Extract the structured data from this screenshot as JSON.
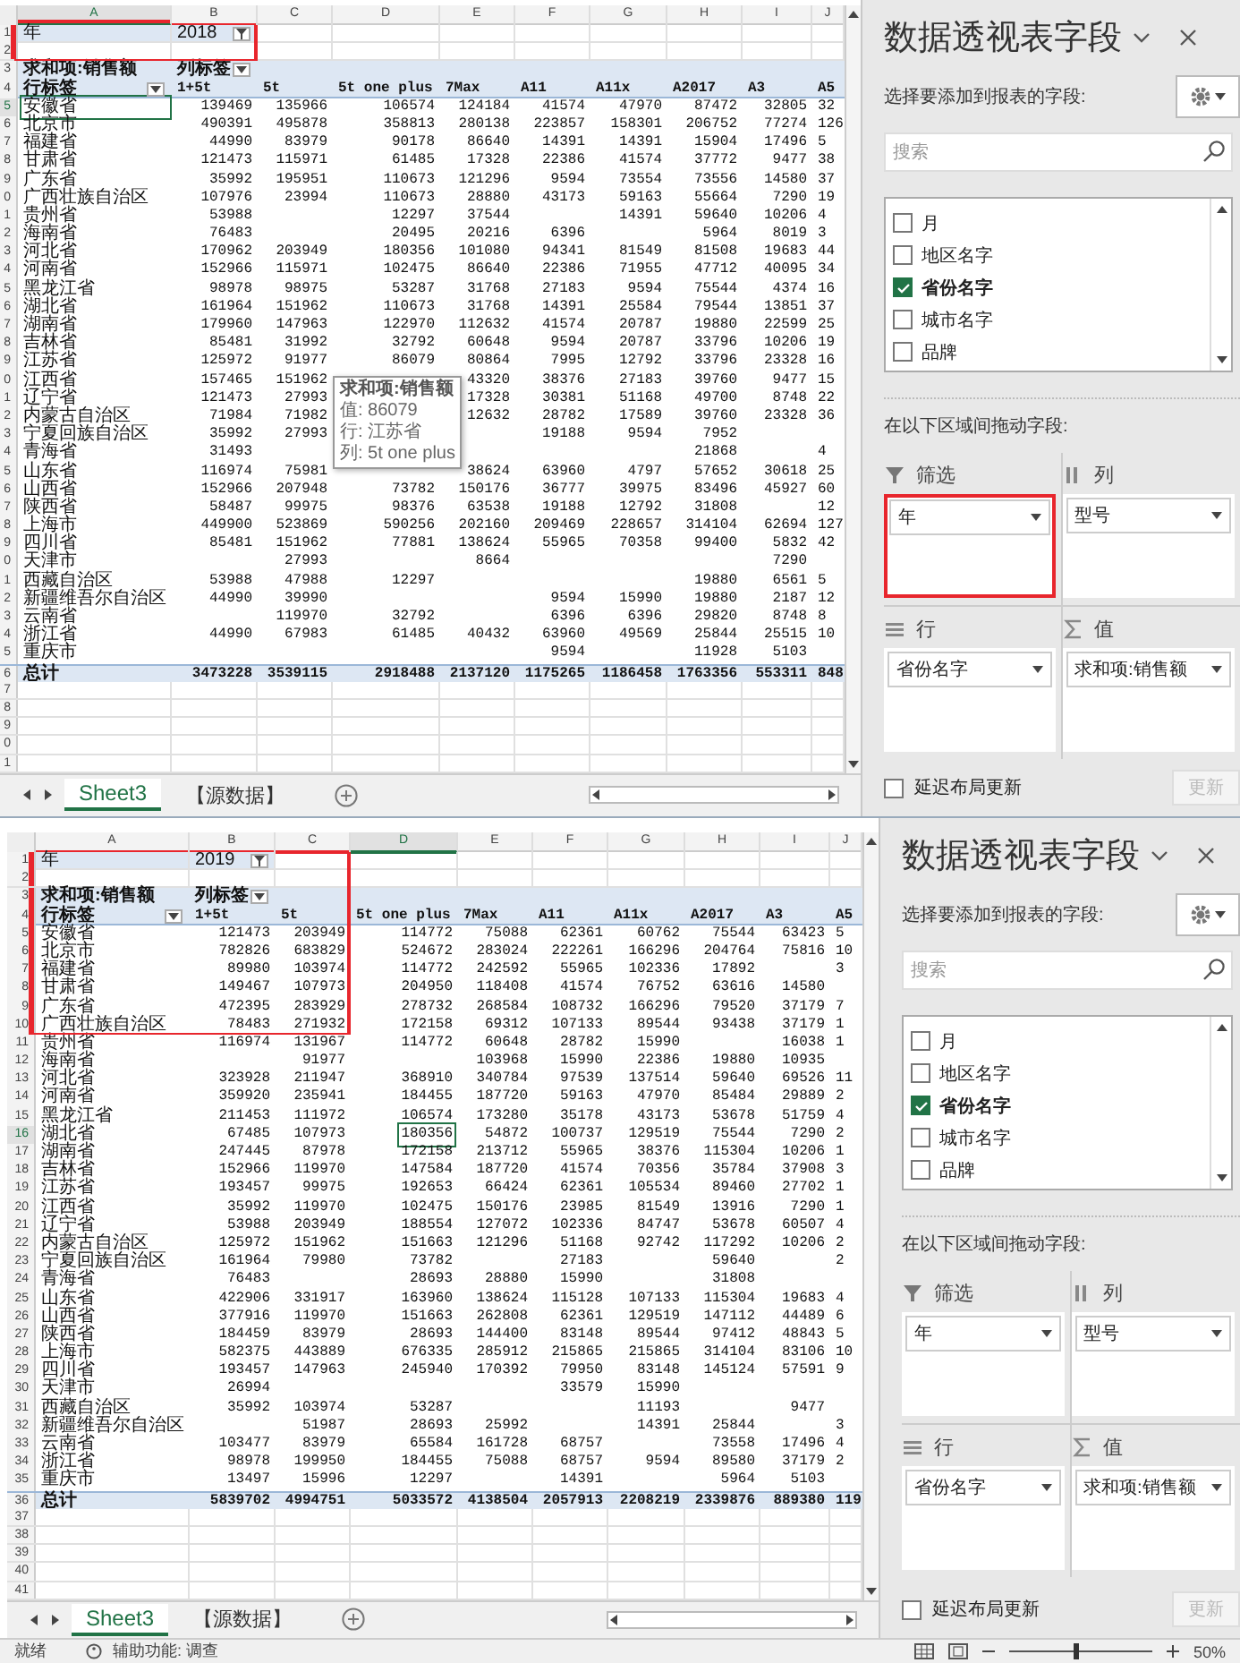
{
  "panes": [
    {
      "sheet": {
        "column_letters": [
          {
            "label": "A",
            "selected": true,
            "framed": true
          },
          {
            "label": "B",
            "selected": false,
            "framed": true
          },
          {
            "label": "C",
            "selected": false,
            "framed": false
          },
          {
            "label": "D",
            "selected": false,
            "framed": false
          },
          {
            "label": "E",
            "selected": false,
            "framed": false
          },
          {
            "label": "F",
            "selected": false,
            "framed": false
          },
          {
            "label": "G",
            "selected": false,
            "framed": false
          },
          {
            "label": "H",
            "selected": false,
            "framed": false
          },
          {
            "label": "I",
            "selected": false,
            "framed": false
          },
          {
            "label": "J",
            "selected": false,
            "framed": false
          }
        ],
        "tooltip": {
          "title": "求和项:销售额",
          "lines": [
            "值: 86079",
            "行: 江苏省",
            "列: 5t one plus"
          ]
        },
        "rows": [
          {
            "kind": "frame",
            "rows": [
              {
                "number": "1",
                "kind": "filter",
                "selected": false,
                "cells": [
                  "年",
                  "2018",
                  null,
                  null,
                  null,
                  null,
                  null,
                  null,
                  null,
                  null
                ]
              },
              {
                "number": "2",
                "kind": "blank",
                "selected": false
              }
            ]
          },
          {
            "number": "3",
            "kind": "header",
            "selected": false,
            "cells": [
              "求和项:销售额",
              "列标签",
              null,
              null,
              null,
              null,
              null,
              null,
              null,
              null
            ]
          },
          {
            "number": "4",
            "kind": "columns",
            "selected": false,
            "cells": [
              "行标签",
              "1+5t",
              "5t",
              "5t one plus",
              "7Max",
              "A11",
              "A11x",
              "A2017",
              "A3",
              "A5"
            ]
          },
          {
            "number": "5",
            "kind": "data",
            "selected": true,
            "cells": [
              "安徽省",
              "139469",
              "135966",
              "106574",
              "124184",
              "41574",
              "47970",
              "87472",
              "32805",
              "32"
            ]
          },
          {
            "number": "6",
            "kind": "data",
            "selected": false,
            "cells": [
              "北京市",
              "490391",
              "495878",
              "358813",
              "280138",
              "223857",
              "158301",
              "206752",
              "77274",
              "126"
            ]
          },
          {
            "number": "7",
            "kind": "data",
            "selected": false,
            "cells": [
              "福建省",
              "44990",
              "83979",
              "90178",
              "86640",
              "14391",
              "14391",
              "15904",
              "17496",
              "5"
            ]
          },
          {
            "number": "8",
            "kind": "data",
            "selected": false,
            "cells": [
              "甘肃省",
              "121473",
              "115971",
              "61485",
              "17328",
              "22386",
              "41574",
              "37772",
              "9477",
              "38"
            ]
          },
          {
            "number": "9",
            "kind": "data",
            "selected": false,
            "cells": [
              "广东省",
              "35992",
              "195951",
              "110673",
              "121296",
              "9594",
              "73554",
              "73556",
              "14580",
              "37"
            ]
          },
          {
            "number": "0",
            "kind": "data",
            "selected": false,
            "cells": [
              "广西壮族自治区",
              "107976",
              "23994",
              "110673",
              "28880",
              "43173",
              "59163",
              "55664",
              "7290",
              "19"
            ]
          },
          {
            "number": "1",
            "kind": "data",
            "selected": false,
            "cells": [
              "贵州省",
              "53988",
              null,
              "12297",
              "37544",
              null,
              "14391",
              "59640",
              "10206",
              "4"
            ]
          },
          {
            "number": "2",
            "kind": "data",
            "selected": false,
            "cells": [
              "海南省",
              "76483",
              null,
              "20495",
              "20216",
              "6396",
              null,
              "5964",
              "8019",
              "3"
            ]
          },
          {
            "number": "3",
            "kind": "data",
            "selected": false,
            "cells": [
              "河北省",
              "170962",
              "203949",
              "180356",
              "101080",
              "94341",
              "81549",
              "81508",
              "19683",
              "44"
            ]
          },
          {
            "number": "4",
            "kind": "data",
            "selected": false,
            "cells": [
              "河南省",
              "152966",
              "115971",
              "102475",
              "86640",
              "22386",
              "71955",
              "47712",
              "40095",
              "34"
            ]
          },
          {
            "number": "5",
            "kind": "data",
            "selected": false,
            "cells": [
              "黑龙江省",
              "98978",
              "98975",
              "53287",
              "31768",
              "27183",
              "9594",
              "75544",
              "4374",
              "16"
            ]
          },
          {
            "number": "6",
            "kind": "data",
            "selected": false,
            "cells": [
              "湖北省",
              "161964",
              "151962",
              "110673",
              "31768",
              "14391",
              "25584",
              "79544",
              "13851",
              "37"
            ]
          },
          {
            "number": "7",
            "kind": "data",
            "selected": false,
            "cells": [
              "湖南省",
              "179960",
              "147963",
              "122970",
              "112632",
              "41574",
              "20787",
              "19880",
              "22599",
              "25"
            ]
          },
          {
            "number": "8",
            "kind": "data",
            "selected": false,
            "cells": [
              "吉林省",
              "85481",
              "31992",
              "32792",
              "60648",
              "9594",
              "20787",
              "33796",
              "10206",
              "19"
            ]
          },
          {
            "number": "9",
            "kind": "data",
            "selected": false,
            "cells": [
              "江苏省",
              "125972",
              "91977",
              "86079",
              "80864",
              "7995",
              "12792",
              "33796",
              "23328",
              "16"
            ]
          },
          {
            "number": "0",
            "kind": "data",
            "selected": false,
            "cells": [
              "江西省",
              "157465",
              "151962",
              null,
              "43320",
              "38376",
              "27183",
              "39760",
              "9477",
              "15"
            ]
          },
          {
            "number": "1",
            "kind": "data",
            "selected": false,
            "cells": [
              "辽宁省",
              "121473",
              "27993",
              null,
              "17328",
              "30381",
              "51168",
              "49700",
              "8748",
              "22"
            ]
          },
          {
            "number": "2",
            "kind": "data",
            "selected": false,
            "cells": [
              "内蒙古自治区",
              "71984",
              "71982",
              null,
              "12632",
              "28782",
              "17589",
              "39760",
              "23328",
              "36"
            ]
          },
          {
            "number": "3",
            "kind": "data",
            "selected": false,
            "cells": [
              "宁夏回族自治区",
              "35992",
              "27993",
              null,
              null,
              "19188",
              "9594",
              "7952",
              null,
              null
            ]
          },
          {
            "number": "4",
            "kind": "data",
            "selected": false,
            "cells": [
              "青海省",
              "31493",
              null,
              null,
              null,
              null,
              null,
              "21868",
              null,
              "4"
            ]
          },
          {
            "number": "5",
            "kind": "data",
            "selected": false,
            "cells": [
              "山东省",
              "116974",
              "75981",
              null,
              "38624",
              "63960",
              "4797",
              "57652",
              "30618",
              "25"
            ]
          },
          {
            "number": "6",
            "kind": "data",
            "selected": false,
            "cells": [
              "山西省",
              "152966",
              "207948",
              "73782",
              "150176",
              "36777",
              "39975",
              "83496",
              "45927",
              "60"
            ]
          },
          {
            "number": "7",
            "kind": "data",
            "selected": false,
            "cells": [
              "陕西省",
              "58487",
              "99975",
              "98376",
              "63538",
              "19188",
              "12792",
              "31808",
              null,
              "12"
            ]
          },
          {
            "number": "8",
            "kind": "data",
            "selected": false,
            "cells": [
              "上海市",
              "449900",
              "523869",
              "590256",
              "202160",
              "209469",
              "228657",
              "314104",
              "62694",
              "127"
            ]
          },
          {
            "number": "9",
            "kind": "data",
            "selected": false,
            "cells": [
              "四川省",
              "85481",
              "151962",
              "77881",
              "138624",
              "55965",
              "70358",
              "99400",
              "5832",
              "42"
            ]
          },
          {
            "number": "0",
            "kind": "data",
            "selected": false,
            "cells": [
              "天津市",
              null,
              "27993",
              null,
              "8664",
              null,
              null,
              null,
              "7290",
              null
            ]
          },
          {
            "number": "1",
            "kind": "data",
            "selected": false,
            "cells": [
              "西藏自治区",
              "53988",
              "47988",
              "12297",
              null,
              null,
              null,
              "19880",
              "6561",
              "5"
            ]
          },
          {
            "number": "2",
            "kind": "data",
            "selected": false,
            "cells": [
              "新疆维吾尔自治区",
              "44990",
              "39990",
              null,
              null,
              "9594",
              "15990",
              "19880",
              "2187",
              "12"
            ]
          },
          {
            "number": "3",
            "kind": "data",
            "selected": false,
            "cells": [
              "云南省",
              null,
              "119970",
              "32792",
              null,
              "6396",
              "6396",
              "29820",
              "8748",
              "8"
            ]
          },
          {
            "number": "4",
            "kind": "data",
            "selected": false,
            "cells": [
              "浙江省",
              "44990",
              "67983",
              "61485",
              "40432",
              "63960",
              "49569",
              "25844",
              "25515",
              "10"
            ]
          },
          {
            "number": "5",
            "kind": "data",
            "selected": false,
            "cells": [
              "重庆市",
              null,
              null,
              null,
              null,
              "9594",
              null,
              "11928",
              "5103",
              null
            ]
          },
          {
            "number": "6",
            "kind": "total",
            "selected": false,
            "cells": [
              "总计",
              "3473228",
              "3539115",
              "2918488",
              "2137120",
              "1175265",
              "1186458",
              "1763356",
              "553311",
              "848"
            ]
          },
          {
            "number": "7",
            "kind": "blank",
            "selected": false
          },
          {
            "number": "8",
            "kind": "blank",
            "selected": false
          },
          {
            "number": "9",
            "kind": "blank",
            "selected": false
          },
          {
            "number": "0",
            "kind": "blank",
            "selected": false
          },
          {
            "number": "1",
            "kind": "blank",
            "selected": false
          }
        ]
      },
      "sheet_tabs": [
        {
          "label": "Sheet3",
          "selected": true
        },
        {
          "label": "【源数据】",
          "selected": false
        }
      ],
      "panel": {
        "title": "数据透视表字段",
        "subtitle": "选择要添加到报表的字段:",
        "search": {
          "placeholder": "搜索"
        },
        "fields": [
          {
            "label": "月",
            "checked": false
          },
          {
            "label": "地区名字",
            "checked": false
          },
          {
            "label": "省份名字",
            "checked": true
          },
          {
            "label": "城市名字",
            "checked": false
          },
          {
            "label": "品牌",
            "checked": false
          }
        ],
        "areas_caption": "在以下区域间拖动字段:",
        "areas": [
          {
            "kind": "filter",
            "label": "筛选",
            "chip": "年",
            "highlighted": true
          },
          {
            "kind": "columns",
            "label": "列",
            "chip": "型号",
            "highlighted": false
          },
          {
            "kind": "rows",
            "label": "行",
            "chip": "省份名字",
            "highlighted": false
          },
          {
            "kind": "values",
            "label": "值",
            "chip": "求和项:销售额",
            "highlighted": false
          }
        ],
        "defer": {
          "label": "延迟布局更新",
          "checked": false
        },
        "update_button": {
          "label": "更新",
          "disabled": true
        }
      }
    },
    {
      "sheet": {
        "column_letters": [
          {
            "label": "A",
            "selected": false,
            "framed": true
          },
          {
            "label": "B",
            "selected": false,
            "framed": true
          },
          {
            "label": "C",
            "selected": false,
            "framed": true
          },
          {
            "label": "D",
            "selected": true,
            "framed": false
          },
          {
            "label": "E",
            "selected": false,
            "framed": false
          },
          {
            "label": "F",
            "selected": false,
            "framed": false
          },
          {
            "label": "G",
            "selected": false,
            "framed": false
          },
          {
            "label": "H",
            "selected": false,
            "framed": false
          },
          {
            "label": "I",
            "selected": false,
            "framed": false
          },
          {
            "label": "J",
            "selected": false,
            "framed": false
          }
        ],
        "rows": [
          {
            "kind": "frame",
            "rows": [
              {
                "number": "1",
                "kind": "filter",
                "selected": false,
                "cells": [
                  "年",
                  "2019",
                  null,
                  null,
                  null,
                  null,
                  null,
                  null,
                  null,
                  null
                ]
              },
              {
                "number": "2",
                "kind": "blank",
                "selected": false
              },
              {
                "number": "3",
                "kind": "header",
                "selected": false,
                "cells": [
                  "求和项:销售额",
                  "列标签",
                  null,
                  null,
                  null,
                  null,
                  null,
                  null,
                  null,
                  null
                ]
              },
              {
                "number": "4",
                "kind": "columns",
                "selected": false,
                "cells": [
                  "行标签",
                  "1+5t",
                  "5t",
                  "5t one plus",
                  "7Max",
                  "A11",
                  "A11x",
                  "A2017",
                  "A3",
                  "A5"
                ]
              },
              {
                "number": "5",
                "kind": "data",
                "selected": false,
                "cells": [
                  "安徽省",
                  "121473",
                  "203949",
                  "114772",
                  "75088",
                  "62361",
                  "60762",
                  "75544",
                  "63423",
                  "5"
                ]
              },
              {
                "number": "6",
                "kind": "data",
                "selected": false,
                "cells": [
                  "北京市",
                  "782826",
                  "683829",
                  "524672",
                  "283024",
                  "222261",
                  "166296",
                  "204764",
                  "75816",
                  "10"
                ]
              },
              {
                "number": "7",
                "kind": "data",
                "selected": false,
                "cells": [
                  "福建省",
                  "89980",
                  "103974",
                  "114772",
                  "242592",
                  "55965",
                  "102336",
                  "17892",
                  null,
                  "3"
                ]
              },
              {
                "number": "8",
                "kind": "data",
                "selected": false,
                "cells": [
                  "甘肃省",
                  "149467",
                  "107973",
                  "204950",
                  "118408",
                  "41574",
                  "76752",
                  "63616",
                  "14580",
                  null
                ]
              },
              {
                "number": "9",
                "kind": "data",
                "selected": false,
                "cells": [
                  "广东省",
                  "472395",
                  "283929",
                  "278732",
                  "268584",
                  "108732",
                  "166296",
                  "79520",
                  "37179",
                  "7"
                ]
              },
              {
                "number": "10",
                "kind": "data",
                "selected": false,
                "cells": [
                  "广西壮族自治区",
                  "78483",
                  "271932",
                  "172158",
                  "69312",
                  "107133",
                  "89544",
                  "93438",
                  "37179",
                  "1"
                ]
              }
            ]
          },
          {
            "number": "11",
            "kind": "data",
            "selected": false,
            "cells": [
              "贵州省",
              "116974",
              "131967",
              "114772",
              "60648",
              "28782",
              "15990",
              null,
              "16038",
              "1"
            ]
          },
          {
            "number": "12",
            "kind": "data",
            "selected": false,
            "cells": [
              "海南省",
              null,
              "91977",
              null,
              "103968",
              "15990",
              "22386",
              "19880",
              "10935",
              null
            ]
          },
          {
            "number": "13",
            "kind": "data",
            "selected": false,
            "cells": [
              "河北省",
              "323928",
              "211947",
              "368910",
              "340784",
              "97539",
              "137514",
              "59640",
              "69526",
              "11"
            ]
          },
          {
            "number": "14",
            "kind": "data",
            "selected": false,
            "cells": [
              "河南省",
              "359920",
              "235941",
              "184455",
              "187720",
              "59163",
              "47970",
              "85484",
              "29889",
              "2"
            ]
          },
          {
            "number": "15",
            "kind": "data",
            "selected": false,
            "cells": [
              "黑龙江省",
              "211453",
              "111972",
              "106574",
              "173280",
              "35178",
              "43173",
              "53678",
              "51759",
              "4"
            ]
          },
          {
            "number": "16",
            "kind": "data",
            "selected": true,
            "cells": [
              "湖北省",
              "67485",
              "107973",
              "180356",
              "54872",
              "100737",
              "129519",
              "75544",
              "7290",
              "2"
            ]
          },
          {
            "number": "17",
            "kind": "data",
            "selected": false,
            "cells": [
              "湖南省",
              "247445",
              "87978",
              "172158",
              "213712",
              "55965",
              "38376",
              "115304",
              "10206",
              "1"
            ]
          },
          {
            "number": "18",
            "kind": "data",
            "selected": false,
            "cells": [
              "吉林省",
              "152966",
              "119970",
              "147584",
              "187720",
              "41574",
              "70356",
              "35784",
              "37908",
              "3"
            ]
          },
          {
            "number": "19",
            "kind": "data",
            "selected": false,
            "cells": [
              "江苏省",
              "193457",
              "99975",
              "192653",
              "66424",
              "62361",
              "105534",
              "89460",
              "27702",
              "1"
            ]
          },
          {
            "number": "20",
            "kind": "data",
            "selected": false,
            "cells": [
              "江西省",
              "35992",
              "119970",
              "102475",
              "150176",
              "23985",
              "81549",
              "13916",
              "7290",
              "1"
            ]
          },
          {
            "number": "21",
            "kind": "data",
            "selected": false,
            "cells": [
              "辽宁省",
              "53988",
              "203949",
              "188554",
              "127072",
              "102336",
              "84747",
              "53678",
              "60507",
              "4"
            ]
          },
          {
            "number": "22",
            "kind": "data",
            "selected": false,
            "cells": [
              "内蒙古自治区",
              "125972",
              "151962",
              "151663",
              "121296",
              "51168",
              "92742",
              "117292",
              "10206",
              "2"
            ]
          },
          {
            "number": "23",
            "kind": "data",
            "selected": false,
            "cells": [
              "宁夏回族自治区",
              "161964",
              "79980",
              "73782",
              null,
              "27183",
              null,
              "59640",
              null,
              "2"
            ]
          },
          {
            "number": "24",
            "kind": "data",
            "selected": false,
            "cells": [
              "青海省",
              "76483",
              null,
              "28693",
              "28880",
              "15990",
              null,
              "31808",
              null,
              null
            ]
          },
          {
            "number": "25",
            "kind": "data",
            "selected": false,
            "cells": [
              "山东省",
              "422906",
              "331917",
              "163960",
              "138624",
              "115128",
              "107133",
              "115304",
              "19683",
              "4"
            ]
          },
          {
            "number": "26",
            "kind": "data",
            "selected": false,
            "cells": [
              "山西省",
              "377916",
              "119970",
              "151663",
              "262808",
              "62361",
              "129519",
              "147112",
              "44489",
              "6"
            ]
          },
          {
            "number": "27",
            "kind": "data",
            "selected": false,
            "cells": [
              "陕西省",
              "184459",
              "83979",
              "28693",
              "144400",
              "83148",
              "89544",
              "97412",
              "48843",
              "5"
            ]
          },
          {
            "number": "28",
            "kind": "data",
            "selected": false,
            "cells": [
              "上海市",
              "582375",
              "443889",
              "676335",
              "285912",
              "215865",
              "215865",
              "314104",
              "83106",
              "10"
            ]
          },
          {
            "number": "29",
            "kind": "data",
            "selected": false,
            "cells": [
              "四川省",
              "193457",
              "147963",
              "245940",
              "170392",
              "79950",
              "83148",
              "145124",
              "57591",
              "9"
            ]
          },
          {
            "number": "30",
            "kind": "data",
            "selected": false,
            "cells": [
              "天津市",
              "26994",
              null,
              null,
              null,
              "33579",
              "15990",
              null,
              null,
              null
            ]
          },
          {
            "number": "31",
            "kind": "data",
            "selected": false,
            "cells": [
              "西藏自治区",
              "35992",
              "103974",
              "53287",
              null,
              null,
              "11193",
              null,
              "9477",
              null
            ]
          },
          {
            "number": "32",
            "kind": "data",
            "selected": false,
            "cells": [
              "新疆维吾尔自治区",
              null,
              "51987",
              "28693",
              "25992",
              null,
              "14391",
              "25844",
              null,
              "3"
            ]
          },
          {
            "number": "33",
            "kind": "data",
            "selected": false,
            "cells": [
              "云南省",
              "103477",
              "83979",
              "65584",
              "161728",
              "68757",
              null,
              "73558",
              "17496",
              "4"
            ]
          },
          {
            "number": "34",
            "kind": "data",
            "selected": false,
            "cells": [
              "浙江省",
              "98978",
              "199950",
              "184455",
              "75088",
              "68757",
              "9594",
              "89580",
              "37179",
              "2"
            ]
          },
          {
            "number": "35",
            "kind": "data",
            "selected": false,
            "cells": [
              "重庆市",
              "13497",
              "15996",
              "12297",
              null,
              "14391",
              null,
              "5964",
              "5103",
              null
            ]
          },
          {
            "number": "36",
            "kind": "total",
            "selected": false,
            "cells": [
              "总计",
              "5839702",
              "4994751",
              "5033572",
              "4138504",
              "2057913",
              "2208219",
              "2339876",
              "889380",
              "119"
            ]
          },
          {
            "number": "37",
            "kind": "blank",
            "selected": false
          },
          {
            "number": "38",
            "kind": "blank",
            "selected": false
          },
          {
            "number": "39",
            "kind": "blank",
            "selected": false
          },
          {
            "number": "40",
            "kind": "blank",
            "selected": false
          },
          {
            "number": "41",
            "kind": "blank",
            "selected": false
          }
        ]
      },
      "sheet_tabs": [
        {
          "label": "Sheet3",
          "selected": true
        },
        {
          "label": "【源数据】",
          "selected": false
        }
      ],
      "panel": {
        "title": "数据透视表字段",
        "subtitle": "选择要添加到报表的字段:",
        "search": {
          "placeholder": "搜索"
        },
        "fields": [
          {
            "label": "月",
            "checked": false
          },
          {
            "label": "地区名字",
            "checked": false
          },
          {
            "label": "省份名字",
            "checked": true
          },
          {
            "label": "城市名字",
            "checked": false
          },
          {
            "label": "品牌",
            "checked": false
          }
        ],
        "areas_caption": "在以下区域间拖动字段:",
        "areas": [
          {
            "kind": "filter",
            "label": "筛选",
            "chip": "年",
            "highlighted": false
          },
          {
            "kind": "columns",
            "label": "列",
            "chip": "型号",
            "highlighted": false
          },
          {
            "kind": "rows",
            "label": "行",
            "chip": "省份名字",
            "highlighted": false
          },
          {
            "kind": "values",
            "label": "值",
            "chip": "求和项:销售额",
            "highlighted": false
          }
        ],
        "defer": {
          "label": "延迟布局更新",
          "checked": false
        },
        "update_button": {
          "label": "更新",
          "disabled": true
        }
      },
      "status_bar": {
        "state": "就绪",
        "accessibility": "辅助功能: 调查",
        "zoom": {
          "label": "50%",
          "level": 0.45
        }
      }
    }
  ]
}
